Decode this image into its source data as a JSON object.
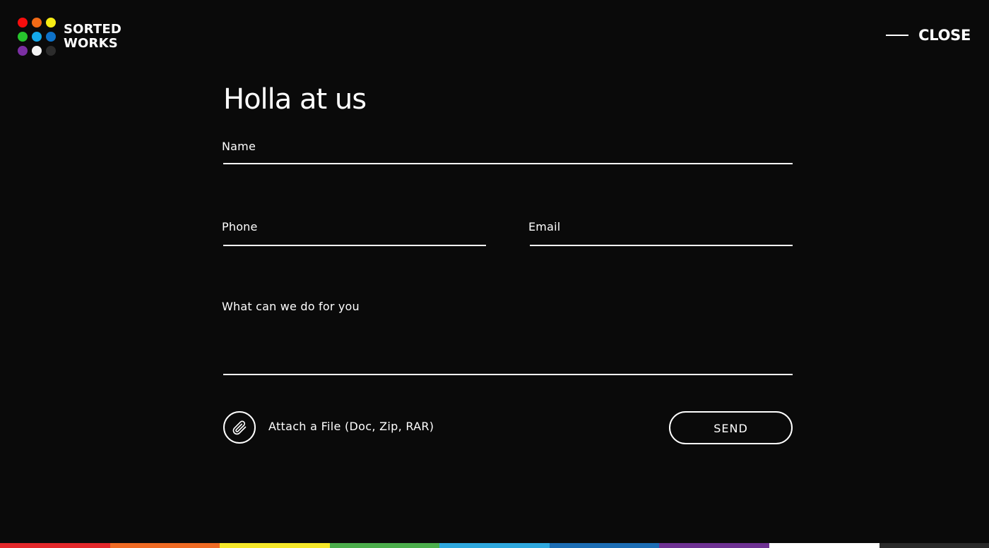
{
  "brand": {
    "line1": "SORTED",
    "line2": "WORKS",
    "dot_colors": [
      "#f70d0d",
      "#f26a16",
      "#f7ec14",
      "#27c42d",
      "#14a9ea",
      "#0e72c8",
      "#7b2fa3",
      "#f4f4f4",
      "#2c2c2c"
    ]
  },
  "header": {
    "close_label": "CLOSE"
  },
  "form": {
    "title": "Holla at us",
    "name_label": "Name",
    "phone_label": "Phone",
    "email_label": "Email",
    "message_label": "What can we do for you",
    "attach_label": "Attach a File (Doc, Zip, RAR)",
    "send_label": "SEND"
  },
  "footer": {
    "stripe_colors": [
      "#e3282b",
      "#ef6b24",
      "#f5e72a",
      "#4cae4c",
      "#2fa8de",
      "#1c6db4",
      "#6e3192",
      "#ffffff",
      "#2a2a2a"
    ]
  }
}
